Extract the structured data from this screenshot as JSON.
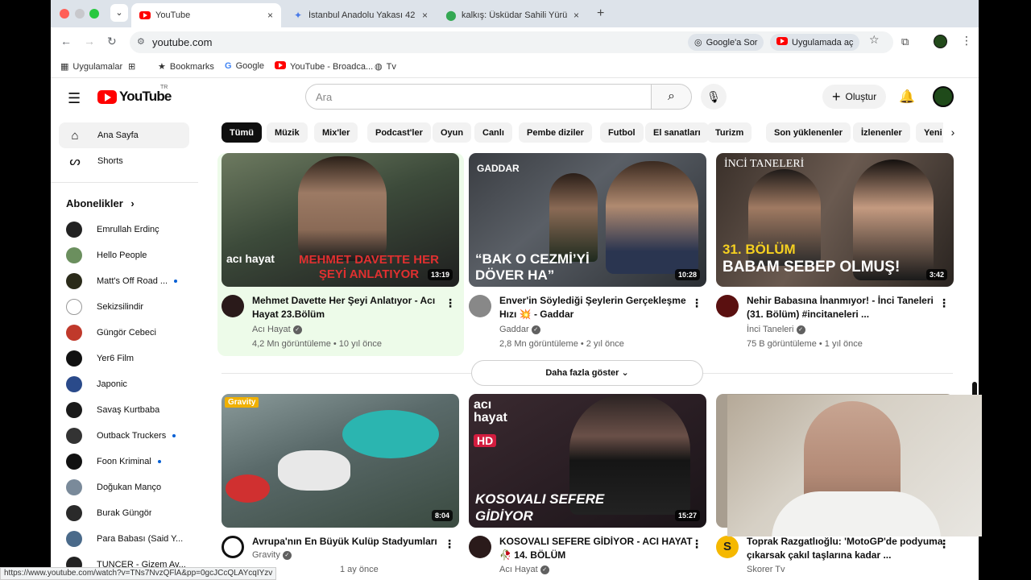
{
  "browser": {
    "tab_dropdown": "⌄",
    "tabs": [
      {
        "title": "YouTube",
        "close": "×"
      },
      {
        "title": "İstanbul Anadolu Yakası 42 K",
        "close": "×"
      },
      {
        "title": "kalkış: Üsküdar Sahili Yürüme",
        "close": "×"
      }
    ],
    "new_tab": "+",
    "url": "youtube.com",
    "ask_google": "Google'a Sor",
    "open_in_app": "Uygulamada aç",
    "bookmarks": [
      {
        "label": "Uygulamalar"
      },
      {
        "label": ""
      },
      {
        "label": "Bookmarks"
      },
      {
        "label": "Google"
      },
      {
        "label": "YouTube - Broadca..."
      },
      {
        "label": "Tv"
      }
    ],
    "status_url": "https://www.youtube.com/watch?v=TNs7NvzQFlA&pp=0gcJCcQLAYcqIYzv"
  },
  "youtube": {
    "logo_text": "YouTube",
    "region": "TR",
    "search_placeholder": "Ara",
    "create_label": "Oluştur",
    "sidebar": [
      {
        "label": "Ana Sayfa",
        "icon": "home-icon"
      },
      {
        "label": "Shorts",
        "icon": "shorts-icon"
      }
    ],
    "subscriptions_title": "Abonelikler",
    "subscriptions_chevron": "›",
    "subscriptions": [
      {
        "name": "Emrullah Erdinç",
        "color": "#222222",
        "dot": false
      },
      {
        "name": "Hello People",
        "color": "#6b8f5e",
        "dot": false
      },
      {
        "name": "Matt's Off Road ...",
        "color": "#2b2b1a",
        "dot": true
      },
      {
        "name": "Sekizsilindir",
        "color": "#ffffff",
        "dot": false
      },
      {
        "name": "Güngör Cebeci",
        "color": "#c0392b",
        "dot": false
      },
      {
        "name": "Yer6 Film",
        "color": "#111111",
        "dot": false
      },
      {
        "name": "Japonic",
        "color": "#2a4a8a",
        "dot": false
      },
      {
        "name": "Savaş Kurtbaba",
        "color": "#1a1a1a",
        "dot": false
      },
      {
        "name": "Outback Truckers",
        "color": "#333333",
        "dot": true
      },
      {
        "name": "Foon Kriminal",
        "color": "#111111",
        "dot": true
      },
      {
        "name": "Doğukan Manço",
        "color": "#7a8a9a",
        "dot": false
      },
      {
        "name": "Burak Güngör",
        "color": "#2a2a2a",
        "dot": false
      },
      {
        "name": "Para Babası (Said Y...",
        "color": "#4a6a8a",
        "dot": false
      },
      {
        "name": "TUNCER - Gizem Av...",
        "color": "#222222",
        "dot": false
      }
    ],
    "chips": [
      "Tümü",
      "Müzik",
      "Mix'ler",
      "Podcast'ler",
      "Oyun",
      "Canlı",
      "Pembe diziler",
      "Futbol",
      "El sanatları",
      "Turizm",
      "Son yüklenenler",
      "İzlenenler",
      "Yeni"
    ],
    "chip_next": "›",
    "more_button": "Daha fazla göster",
    "videos_row1": [
      {
        "title": "Mehmet Davette Her Şeyi Anlatıyor - Acı Hayat 23.Bölüm",
        "channel": "Acı Hayat",
        "meta": "4,2 Mn görüntüleme • 10 yıl önce",
        "duration": "13:19",
        "thumb_text": "MEHMET DAVETTE HER ŞEYİ ANLATIYOR",
        "logo": "acı hayat"
      },
      {
        "title": "Enver'in Söylediği Şeylerin Gerçekleşme Hızı 💥 - Gaddar",
        "channel": "Gaddar",
        "meta": "2,8 Mn görüntüleme • 2 yıl önce",
        "duration": "10:28",
        "thumb_text": "“BAK O CEZMİ’Yİ DÖVER HA”",
        "logo": "GADDAR"
      },
      {
        "title": "Nehir Babasına İnanmıyor! - İnci Taneleri (31. Bölüm) #incitaneleri ...",
        "channel": "İnci Taneleri",
        "meta": "75 B görüntüleme • 1 yıl önce",
        "duration": "3:42",
        "thumb_text_1": "31. BÖLÜM",
        "thumb_text_2": "BABAM SEBEP OLMUŞ!",
        "logo": "İNCİ TANELERİ"
      }
    ],
    "videos_row2": [
      {
        "title": "Avrupa'nın En Büyük Kulüp Stadyumları",
        "channel": "Gravity",
        "meta": "1 ay önce",
        "duration": "8:04",
        "logo": "Gravity"
      },
      {
        "title": "KOSOVALI SEFERE GİDİYOR - ACI HAYAT 🥀 14. BÖLÜM",
        "channel": "Acı Hayat",
        "meta": "",
        "duration": "15:27",
        "thumb_text": "KOSOVALI SEFERE GİDİYOR",
        "badge": "HD",
        "logo": "acı hayat"
      },
      {
        "title": "Toprak Razgatlıoğlu: 'MotoGP'de podyuma çıkarsak çakıl taşlarına kadar ...",
        "channel": "Skorer Tv",
        "meta": "",
        "duration": "",
        "avatar_letter": "S"
      }
    ],
    "kebab": "⋮",
    "check": "✓"
  }
}
